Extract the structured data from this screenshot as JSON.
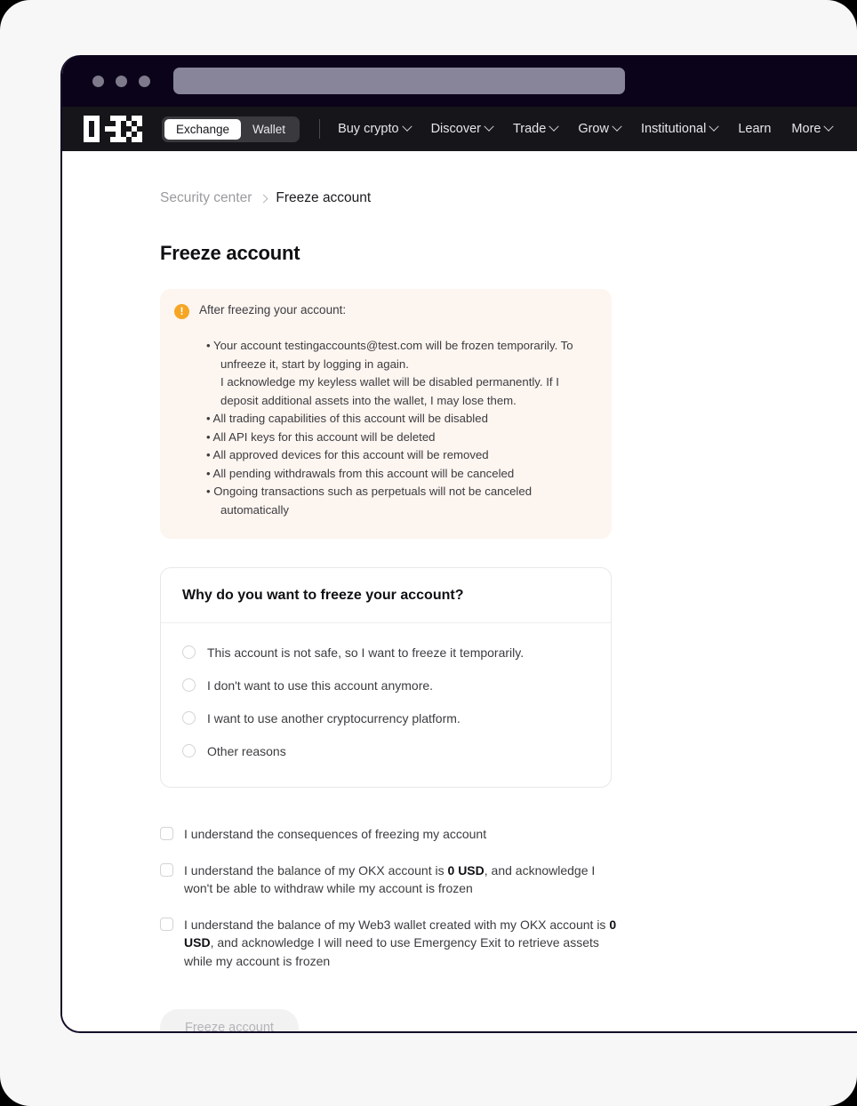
{
  "browser": {
    "traffic_lights": [
      "close",
      "minimize",
      "maximize"
    ],
    "url_value": ""
  },
  "nav": {
    "logo": "okx-logo",
    "segmented": {
      "options": [
        "Exchange",
        "Wallet"
      ],
      "selected": "Exchange"
    },
    "links": [
      {
        "label": "Buy crypto",
        "has_caret": true
      },
      {
        "label": "Discover",
        "has_caret": true
      },
      {
        "label": "Trade",
        "has_caret": true
      },
      {
        "label": "Grow",
        "has_caret": true
      },
      {
        "label": "Institutional",
        "has_caret": true
      },
      {
        "label": "Learn",
        "has_caret": false
      },
      {
        "label": "More",
        "has_caret": true
      }
    ]
  },
  "breadcrumb": {
    "parent": "Security center",
    "current": "Freeze account"
  },
  "page": {
    "title": "Freeze account"
  },
  "warning": {
    "icon": "exclamation-icon",
    "heading": "After freezing your account:",
    "lines": [
      "• Your account testingaccounts@test.com will be frozen temporarily. To unfreeze it, start by logging in again.",
      "I acknowledge my keyless wallet will be disabled permanently. If I deposit additional assets into the wallet, I may lose them.",
      "• All trading capabilities of this account will be disabled",
      "• All API keys for this account will be deleted",
      "• All approved devices for this account will be removed",
      "• All pending withdrawals from this account will be canceled",
      "• Ongoing transactions such as perpetuals will not be canceled automatically"
    ],
    "background_color": "#fdf5f0",
    "icon_color": "#f5a623"
  },
  "reason_card": {
    "heading": "Why do you want to freeze your account?",
    "options": [
      {
        "label": "This account is not safe, so I want to freeze it temporarily.",
        "selected": false
      },
      {
        "label": "I don't want to use this account anymore.",
        "selected": false
      },
      {
        "label": "I want to use another cryptocurrency platform.",
        "selected": false
      },
      {
        "label": "Other reasons",
        "selected": false
      }
    ]
  },
  "acknowledgements": [
    {
      "checked": false,
      "parts": [
        {
          "text": "I understand the consequences of freezing my account",
          "bold": false
        }
      ]
    },
    {
      "checked": false,
      "parts": [
        {
          "text": "I understand the balance of my OKX account is ",
          "bold": false
        },
        {
          "text": "0 USD",
          "bold": true
        },
        {
          "text": ", and acknowledge I won't be able to withdraw while my account is frozen",
          "bold": false
        }
      ]
    },
    {
      "checked": false,
      "parts": [
        {
          "text": "I understand the balance of my Web3 wallet created with my OKX account is ",
          "bold": false
        },
        {
          "text": "0 USD",
          "bold": true
        },
        {
          "text": ", and acknowledge I will need to use Emergency Exit to retrieve assets while my account is frozen",
          "bold": false
        }
      ]
    }
  ],
  "submit": {
    "label": "Freeze account",
    "disabled": true
  }
}
